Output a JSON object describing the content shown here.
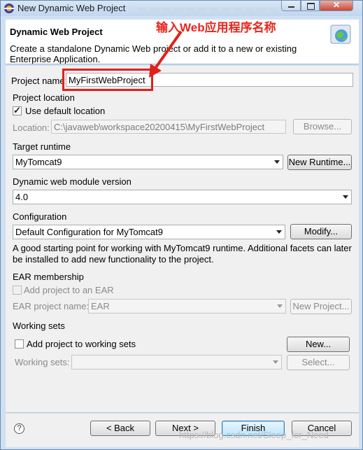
{
  "window": {
    "title": "New Dynamic Web Project",
    "close_color": "#c9463a"
  },
  "header": {
    "title": "Dynamic Web Project",
    "description": "Create a standalone Dynamic Web project or add it to a new or existing Enterprise Application."
  },
  "annotation": {
    "text": "输入Web应用程序名称",
    "color": "#e0201a"
  },
  "project_name": {
    "label": "Project name:",
    "value": "MyFirstWebProject"
  },
  "project_location": {
    "section": "Project location",
    "use_default_label": "Use default location",
    "use_default_checked": true,
    "location_label": "Location:",
    "location_value": "C:\\javaweb\\workspace20200415\\MyFirstWebProject",
    "browse_label": "Browse..."
  },
  "target_runtime": {
    "section": "Target runtime",
    "selected": "MyTomcat9",
    "new_runtime_label": "New Runtime..."
  },
  "module_version": {
    "section": "Dynamic web module version",
    "selected": "4.0"
  },
  "configuration": {
    "section": "Configuration",
    "selected": "Default Configuration for MyTomcat9",
    "modify_label": "Modify...",
    "description": "A good starting point for working with MyTomcat9 runtime. Additional facets can later be installed to add new functionality to the project."
  },
  "ear": {
    "section": "EAR membership",
    "add_label": "Add project to an EAR",
    "add_checked": false,
    "project_name_label": "EAR project name:",
    "project_name_value": "EAR",
    "new_project_label": "New Project..."
  },
  "working_sets": {
    "section": "Working sets",
    "add_label": "Add project to working sets",
    "add_checked": false,
    "new_label": "New...",
    "sets_label": "Working sets:",
    "sets_value": "",
    "select_label": "Select..."
  },
  "footer": {
    "help_icon_text": "?",
    "back_label": "< Back",
    "next_label": "Next >",
    "finish_label": "Finish",
    "cancel_label": "Cancel",
    "watermark": "https://blog.csdn.net/Sleep_for_Need"
  }
}
